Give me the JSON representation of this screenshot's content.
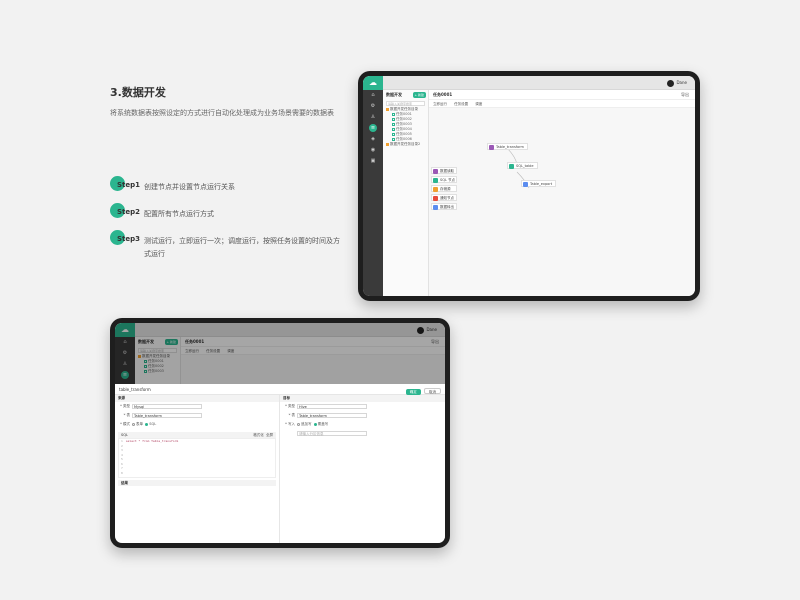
{
  "section": {
    "title": "3.数据开发",
    "description": "将系统数据表按照设定的方式进行自动化处理成为业务场景需要的数据表"
  },
  "steps": [
    {
      "label": "Step1",
      "text": "创建节点并设置节点运行关系"
    },
    {
      "label": "Step2",
      "text": "配置所有节点运行方式"
    },
    {
      "label": "Step3",
      "text": "测试运行，立即运行一次；调度运行，按照任务设置的时间及方式运行"
    }
  ],
  "colors": {
    "accent": "#2bb58f",
    "rail": "#3a3a3a",
    "bezel": "#1e1e1e"
  },
  "app": {
    "logo_icon": "cloud-icon",
    "user_name": "Dane",
    "module_title": "数据开发",
    "add_label": "+ 新建",
    "search_placeholder": "请输入关键字搜索",
    "folder1": "数据开发任务目录",
    "folder2": "数据开发任务目录2",
    "leaves": [
      "任务0001",
      "任务0002",
      "任务0003",
      "任务0004",
      "任务0005",
      "任务0006"
    ],
    "task_tab": "任务0001",
    "export": "导出",
    "toolbar": [
      "立即运行",
      "任务设置",
      "调度"
    ],
    "palette": [
      {
        "label": "数据读取",
        "color": "#9b59b6"
      },
      {
        "label": "SQL 节点",
        "color": "#2bb58f"
      },
      {
        "label": "存储源",
        "color": "#f0a030"
      },
      {
        "label": "通知节点",
        "color": "#e74c3c"
      },
      {
        "label": "数据转出",
        "color": "#5b8def"
      }
    ],
    "flow_nodes": [
      {
        "label": "Table_transform",
        "color": "#9b59b6"
      },
      {
        "label": "SQL_table",
        "color": "#2bb58f"
      },
      {
        "label": "Table_export",
        "color": "#5b8def"
      }
    ]
  },
  "dialog": {
    "title": "table_transform",
    "ok": "确定",
    "cancel": "取消",
    "source_header": "来源",
    "target_header": "目标",
    "source_fields": [
      {
        "label": "* 类型",
        "value": "Mysql"
      },
      {
        "label": "* 表",
        "value": "Table_transform"
      }
    ],
    "target_fields": [
      {
        "label": "* 类型",
        "value": "Hive"
      },
      {
        "label": "* 表",
        "value": "Table_transform"
      }
    ],
    "mode_label": "* 模式",
    "mode_options": [
      "表单",
      "SQL"
    ],
    "write_label": "* 写入",
    "write_options": [
      "追加写",
      "覆盖写"
    ],
    "partition_placeholder": "请输入分区信息",
    "sql_header": "SQL",
    "sql_ops": [
      "格式化",
      "全屏"
    ],
    "sql_line": "select * from Table_transform",
    "result_header": "结果"
  }
}
